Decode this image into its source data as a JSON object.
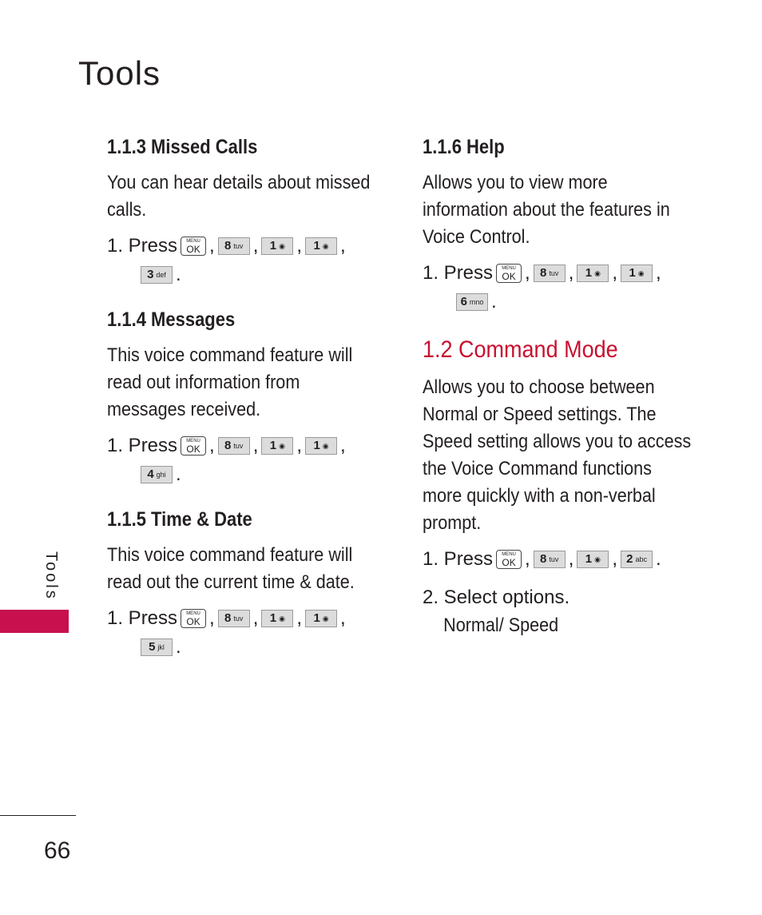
{
  "page_title": "Tools",
  "side_tab": "Tools",
  "page_number": "66",
  "colors": {
    "accent": "#c8102e",
    "tab": "#c8104e",
    "key_bg": "#dcdcdc"
  },
  "left_column": {
    "sections": [
      {
        "heading": "1.1.3 Missed Calls",
        "body": "You can hear details about missed calls.",
        "step_prefix": "1. Press",
        "keys": [
          {
            "main": "MENU OK",
            "icon": "menu-ok-key"
          },
          {
            "main": "8",
            "sub": "tuv"
          },
          {
            "main": "1",
            "sub": "voicemail"
          },
          {
            "main": "1",
            "sub": "voicemail"
          },
          {
            "main": "3",
            "sub": "def"
          }
        ]
      },
      {
        "heading": "1.1.4 Messages",
        "body": "This voice command feature will read out information from messages received.",
        "step_prefix": "1. Press",
        "keys": [
          {
            "main": "MENU OK"
          },
          {
            "main": "8",
            "sub": "tuv"
          },
          {
            "main": "1",
            "sub": "voicemail"
          },
          {
            "main": "1",
            "sub": "voicemail"
          },
          {
            "main": "4",
            "sub": "ghi"
          }
        ]
      },
      {
        "heading": "1.1.5 Time & Date",
        "body": "This voice command feature will read out the current time & date.",
        "step_prefix": "1. Press",
        "keys": [
          {
            "main": "MENU OK"
          },
          {
            "main": "8",
            "sub": "tuv"
          },
          {
            "main": "1",
            "sub": "voicemail"
          },
          {
            "main": "1",
            "sub": "voicemail"
          },
          {
            "main": "5",
            "sub": "jkl"
          }
        ]
      }
    ]
  },
  "right_column": {
    "help": {
      "heading": "1.1.6 Help",
      "body": "Allows you to view more information about the features in Voice Control.",
      "step_prefix": "1. Press",
      "keys": [
        {
          "main": "MENU OK"
        },
        {
          "main": "8",
          "sub": "tuv"
        },
        {
          "main": "1",
          "sub": "voicemail"
        },
        {
          "main": "1",
          "sub": "voicemail"
        },
        {
          "main": "6",
          "sub": "mno"
        }
      ]
    },
    "command_mode": {
      "heading": "1.2 Command Mode",
      "body": "Allows you to choose between Normal or Speed settings. The Speed setting allows you to access the Voice Command functions more quickly with a non-verbal prompt.",
      "step1_prefix": "1. Press",
      "keys": [
        {
          "main": "MENU OK"
        },
        {
          "main": "8",
          "sub": "tuv"
        },
        {
          "main": "1",
          "sub": "voicemail"
        },
        {
          "main": "2",
          "sub": "abc"
        }
      ],
      "step2": "2. Select options.",
      "options": "Normal/ Speed"
    }
  },
  "menu_key": {
    "top": "MENU",
    "bottom": "OK"
  },
  "punct": {
    "comma": ",",
    "period": "."
  }
}
